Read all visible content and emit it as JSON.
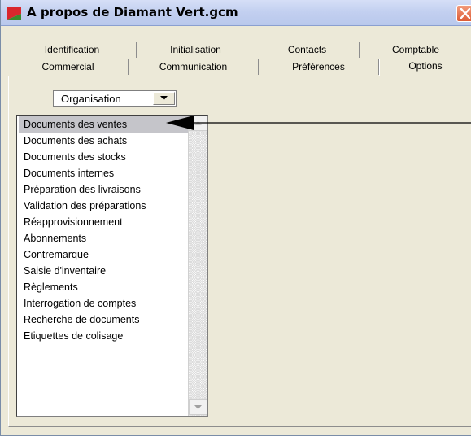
{
  "window": {
    "title": "A propos de Diamant Vert.gcm",
    "app_icon": "app-icon-red-green",
    "close_icon": "close-icon"
  },
  "tabs": {
    "back_row": [
      "Identification",
      "Initialisation",
      "Contacts",
      "Comptable"
    ],
    "front_row": [
      "Commercial",
      "Communication",
      "Préférences",
      "Options"
    ],
    "active": "Options"
  },
  "category_select": {
    "selected": "Organisation",
    "icon": "chevron-down-icon"
  },
  "list": {
    "selected": "Documents des ventes",
    "items": [
      "Documents des ventes",
      "Documents des achats",
      "Documents des stocks",
      "Documents internes",
      "Préparation des livraisons",
      "Validation des préparations",
      "Réapprovisionnement",
      "Abonnements",
      "Contremarque",
      "Saisie d'inventaire",
      "Règlements",
      "Interrogation de comptes",
      "Recherche de documents",
      "Etiquettes de colisage"
    ]
  },
  "colors": {
    "dialog_background": "#ece9d8",
    "selected_item_background": "#c5c5ca",
    "close_button": "#dd5b35"
  }
}
